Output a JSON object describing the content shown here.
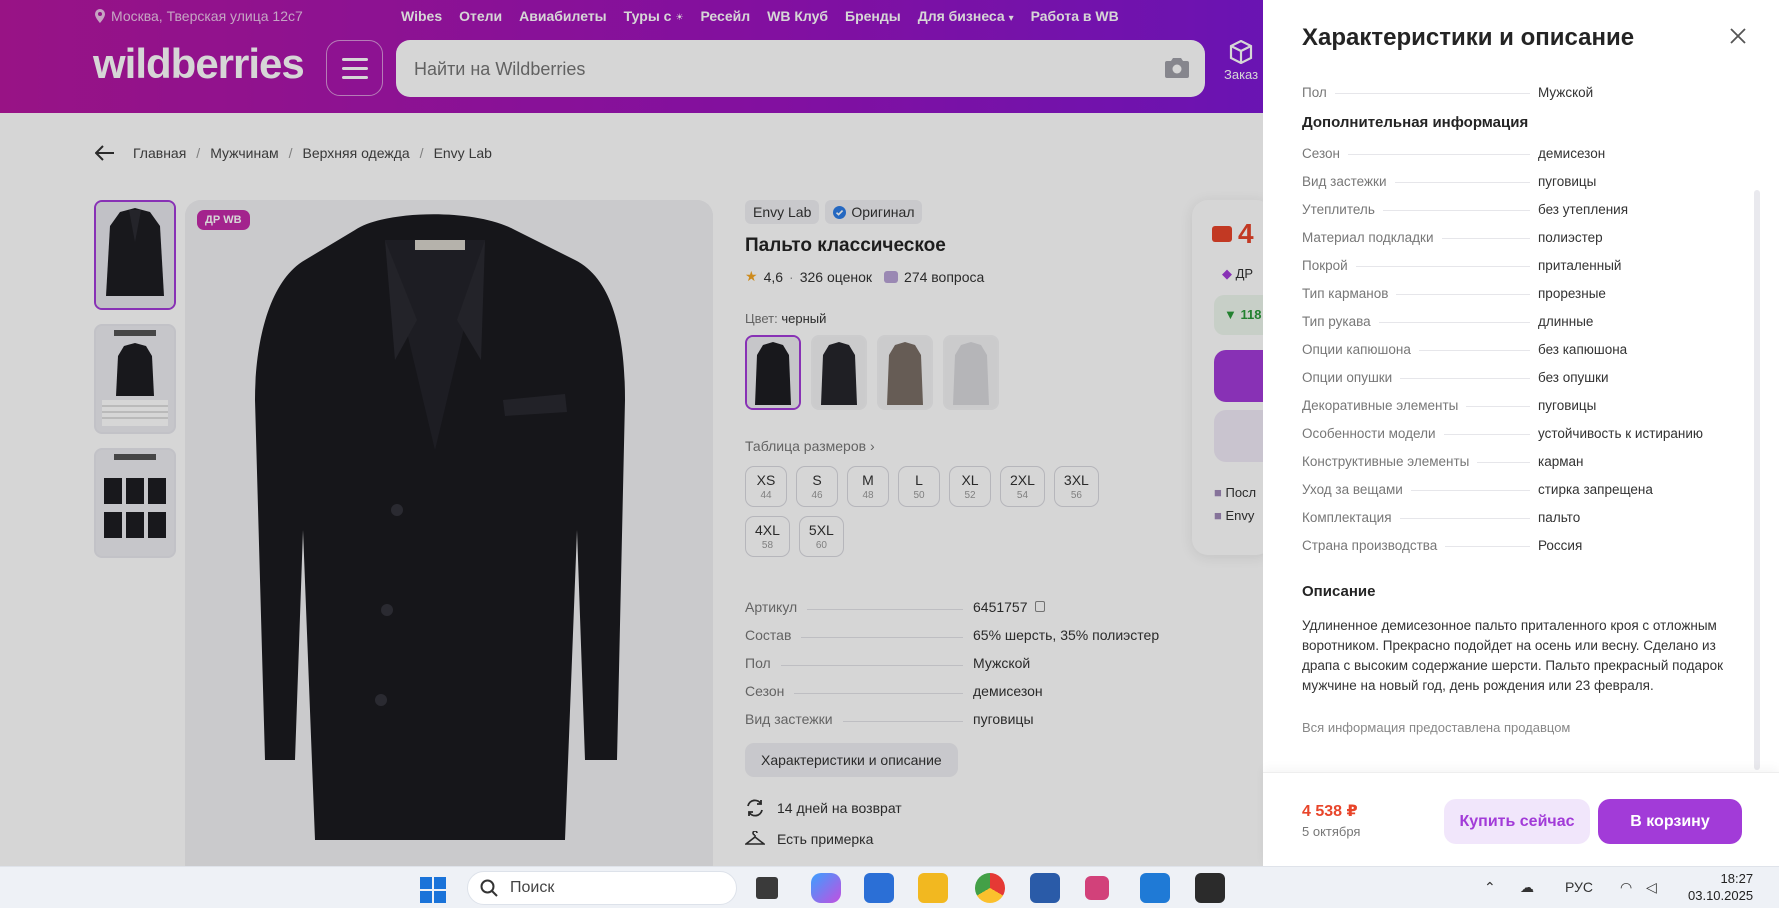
{
  "header": {
    "location": "Москва, Тверская улица 12с7",
    "nav": [
      "Wibes",
      "Отели",
      "Авиабилеты",
      "Туры с",
      "Ресейл",
      "WB Клуб",
      "Бренды",
      "Для бизнеса",
      "Работа в WB"
    ],
    "logo": "wildberries",
    "search_placeholder": "Найти на Wildberries",
    "orders_label": "Заказ"
  },
  "breadcrumbs": [
    "Главная",
    "Мужчинам",
    "Верхняя одежда",
    "Envy Lab"
  ],
  "product": {
    "badge": "ДР WB",
    "brand": "Envy Lab",
    "original": "Оригинал",
    "title": "Пальто классическое",
    "rating": "4,6",
    "reviews": "326 оценок",
    "questions": "274 вопроса",
    "color_label": "Цвет:",
    "color_value": "черный",
    "size_table": "Таблица размеров",
    "sizes": [
      {
        "size": "XS",
        "ru": "44"
      },
      {
        "size": "S",
        "ru": "46"
      },
      {
        "size": "M",
        "ru": "48"
      },
      {
        "size": "L",
        "ru": "50"
      },
      {
        "size": "XL",
        "ru": "52"
      },
      {
        "size": "2XL",
        "ru": "54"
      },
      {
        "size": "3XL",
        "ru": "56"
      },
      {
        "size": "4XL",
        "ru": "58"
      },
      {
        "size": "5XL",
        "ru": "60"
      }
    ],
    "attrs": [
      {
        "k": "Артикул",
        "v": "6451757"
      },
      {
        "k": "Состав",
        "v": "65% шерсть, 35% полиэстер"
      },
      {
        "k": "Пол",
        "v": "Мужской"
      },
      {
        "k": "Сезон",
        "v": "демисезон"
      },
      {
        "k": "Вид застежки",
        "v": "пуговицы"
      }
    ],
    "char_button": "Характеристики и описание",
    "return_note": "14 дней на возврат",
    "fitting_note": "Есть примерка"
  },
  "price_card": {
    "price_fragment": "4",
    "dr_fragment": "ДР",
    "green_fragment": "118",
    "line1": "Посл",
    "line2": "Envy"
  },
  "panel": {
    "title": "Характеристики и описание",
    "first_row": {
      "k": "Пол",
      "v": "Мужской"
    },
    "section_extra": "Дополнительная информация",
    "rows": [
      {
        "k": "Сезон",
        "v": "демисезон"
      },
      {
        "k": "Вид застежки",
        "v": "пуговицы"
      },
      {
        "k": "Утеплитель",
        "v": "без утепления"
      },
      {
        "k": "Материал подкладки",
        "v": "полиэстер"
      },
      {
        "k": "Покрой",
        "v": "приталенный"
      },
      {
        "k": "Тип карманов",
        "v": "прорезные"
      },
      {
        "k": "Тип рукава",
        "v": "длинные"
      },
      {
        "k": "Опции капюшона",
        "v": "без капюшона"
      },
      {
        "k": "Опции опушки",
        "v": "без опушки"
      },
      {
        "k": "Декоративные элементы",
        "v": "пуговицы"
      },
      {
        "k": "Особенности модели",
        "v": "устойчивость к истиранию"
      },
      {
        "k": "Конструктивные элементы",
        "v": "карман"
      },
      {
        "k": "Уход за вещами",
        "v": "стирка запрещена"
      },
      {
        "k": "Комплектация",
        "v": "пальто"
      },
      {
        "k": "Страна производства",
        "v": "Россия"
      }
    ],
    "section_desc": "Описание",
    "description": "Удлиненное демисезонное пальто приталенного кроя с отложным воротником. Прекрасно подойдет на осень или весну. Сделано из драпа с высоким содержание шерсти. Пальто прекрасный подарок мужчине на новый год, день рождения или 23 февраля.",
    "note": "Вся информация предоставлена продавцом",
    "footer_price": "4 538 ₽",
    "footer_date": "5 октября",
    "buy_now": "Купить сейчас",
    "to_cart": "В корзину"
  },
  "taskbar": {
    "search": "Поиск",
    "lang": "РУС",
    "time": "18:27",
    "date": "03.10.2025"
  },
  "colors": {
    "accent": "#a23bd8",
    "price": "#e8452a",
    "header_start": "#b5179f",
    "header_end": "#6a1ee0"
  },
  "icons": [
    "location-icon",
    "burger-icon",
    "camera-icon",
    "orders-box-icon",
    "back-arrow-icon",
    "verified-icon",
    "star-icon",
    "question-icon",
    "chevron-right-icon",
    "copy-icon",
    "return-icon",
    "hanger-icon",
    "close-icon",
    "windows-start-icon",
    "search-icon"
  ]
}
